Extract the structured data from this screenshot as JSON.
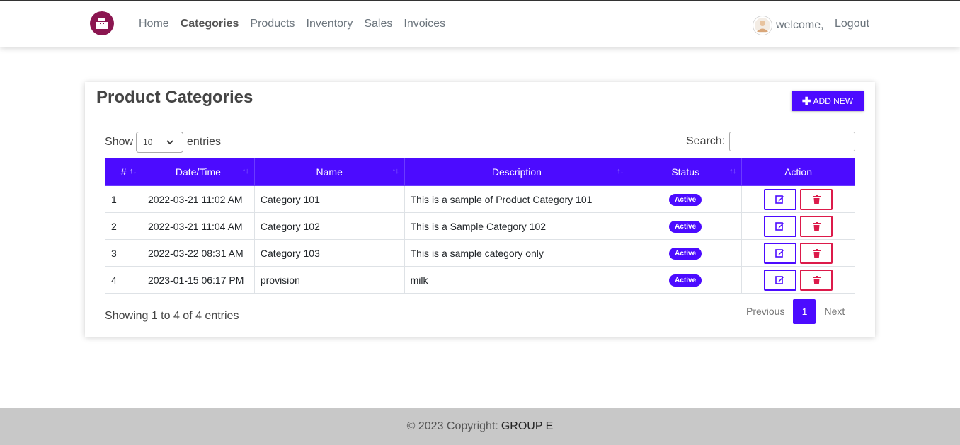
{
  "nav": {
    "links": [
      {
        "label": "Home",
        "active": false
      },
      {
        "label": "Categories",
        "active": true
      },
      {
        "label": "Products",
        "active": false
      },
      {
        "label": "Inventory",
        "active": false
      },
      {
        "label": "Sales",
        "active": false
      },
      {
        "label": "Invoices",
        "active": false
      }
    ],
    "welcome": "welcome,",
    "logout": "Logout",
    "logo_icon": "cash-register-icon",
    "avatar_icon": "user-avatar"
  },
  "page": {
    "title": "Product Categories",
    "add_new_icon": "plus-icon",
    "add_new": "ADD NEW"
  },
  "table_controls": {
    "show_label": "Show",
    "entries_value": "10",
    "entries_label": "entries",
    "search_label": "Search:",
    "search_value": ""
  },
  "table": {
    "headers": [
      "#",
      "Date/Time",
      "Name",
      "Description",
      "Status",
      "Action"
    ],
    "rows": [
      {
        "no": "1",
        "datetime": "2022-03-21 11:02 AM",
        "name": "Category 101",
        "description": "This is a sample of Product Category 101",
        "status": "Active"
      },
      {
        "no": "2",
        "datetime": "2022-03-21 11:04 AM",
        "name": "Category 102",
        "description": "This is a Sample Category 102",
        "status": "Active"
      },
      {
        "no": "3",
        "datetime": "2022-03-22 08:31 AM",
        "name": "Category 103",
        "description": "This is a sample category only",
        "status": "Active"
      },
      {
        "no": "4",
        "datetime": "2023-01-15 06:17 PM",
        "name": "provision",
        "description": "milk",
        "status": "Active"
      }
    ]
  },
  "footer_info": "Showing 1 to 4 of 4 entries",
  "pagination": {
    "previous": "Previous",
    "current": "1",
    "next": "Next"
  },
  "footer": {
    "copyright": "© 2023 Copyright:",
    "brand": "GROUP E"
  },
  "colors": {
    "accent": "#4c0bff",
    "danger": "#dc1a4a",
    "logo": "#8b1650"
  }
}
